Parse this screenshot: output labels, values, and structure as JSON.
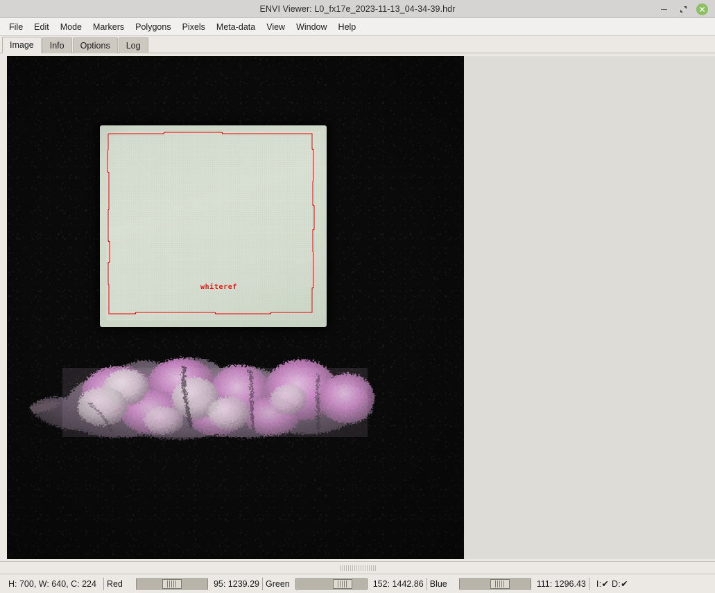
{
  "window": {
    "title": "ENVI Viewer: L0_fx17e_2023-11-13_04-34-39.hdr",
    "minimize_label": "–",
    "maximize_label": "⤡",
    "close_label": "✕"
  },
  "menubar": {
    "items": [
      {
        "label": "File"
      },
      {
        "label": "Edit"
      },
      {
        "label": "Mode"
      },
      {
        "label": "Markers"
      },
      {
        "label": "Polygons"
      },
      {
        "label": "Pixels"
      },
      {
        "label": "Meta-data"
      },
      {
        "label": "View"
      },
      {
        "label": "Window"
      },
      {
        "label": "Help"
      }
    ]
  },
  "tabs": [
    {
      "label": "Image",
      "active": true
    },
    {
      "label": "Info",
      "active": false
    },
    {
      "label": "Options",
      "active": false
    },
    {
      "label": "Log",
      "active": false
    }
  ],
  "canvas": {
    "polygon_label": "whiteref",
    "polygon_color": "#f00000",
    "background_color": "#0a0a0a",
    "whiteref_color": "#d4ddcf",
    "specimen_colors": [
      "#c97fc4",
      "#e0b5dd",
      "#d8d4d0",
      "#8f6f8c",
      "#5c4a5a"
    ]
  },
  "statusbar": {
    "dimensions": "H: 700, W: 640, C: 224",
    "channels": [
      {
        "name": "Red",
        "value": "95: 1239.29",
        "thumb_pct": 36
      },
      {
        "name": "Green",
        "value": "152: 1442.86",
        "thumb_pct": 52
      },
      {
        "name": "Blue",
        "value": "111: 1296.43",
        "thumb_pct": 43
      }
    ],
    "flags": "I:✔ D:✔"
  }
}
